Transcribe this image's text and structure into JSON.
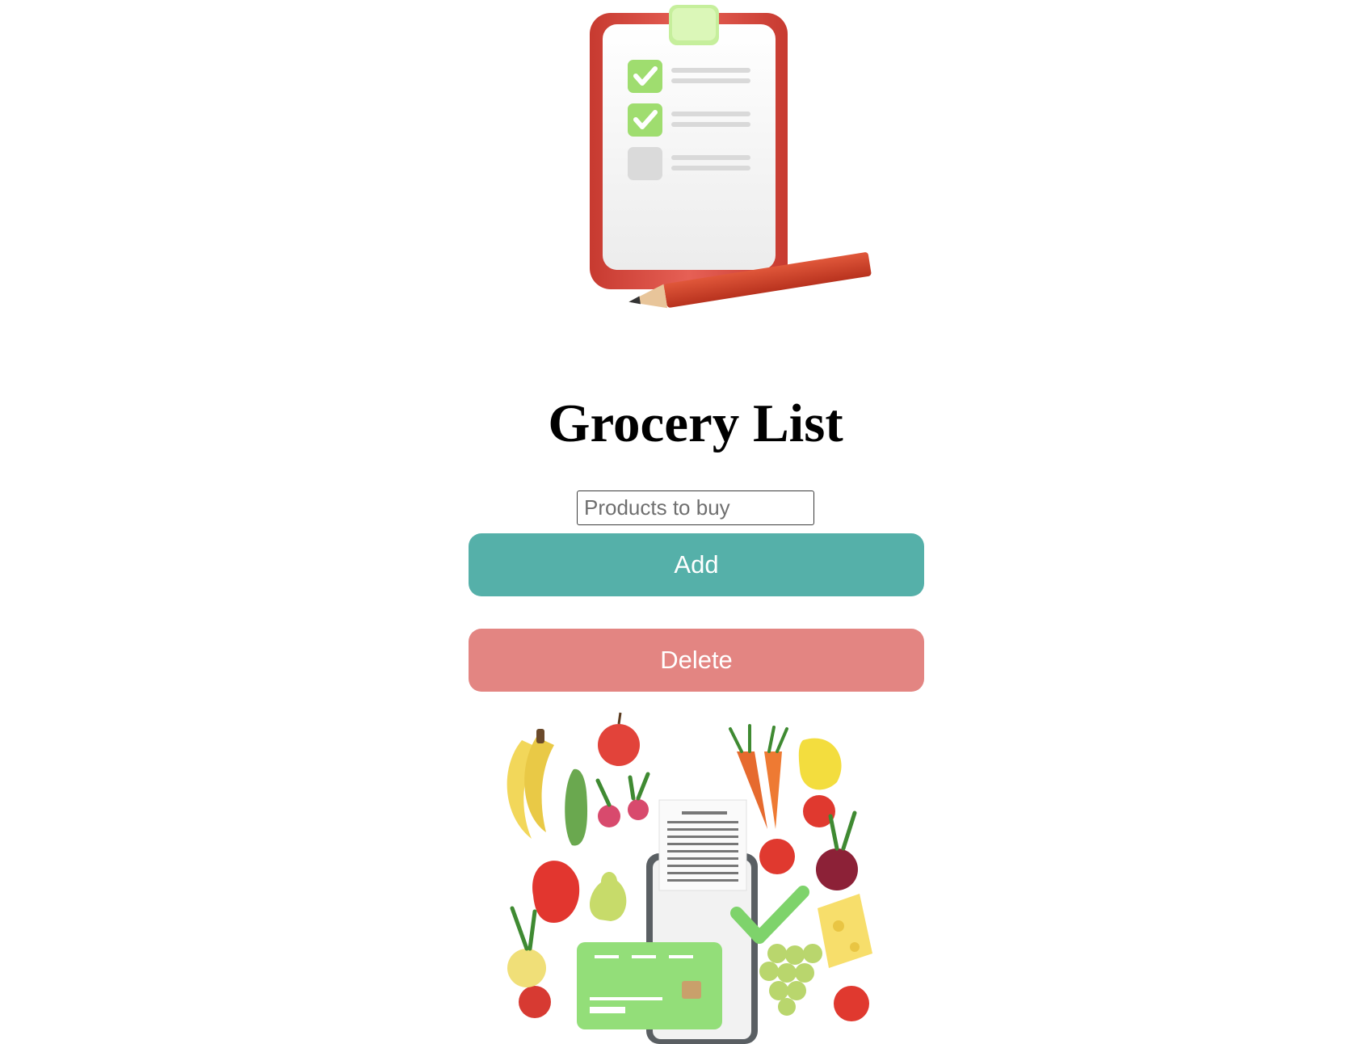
{
  "page": {
    "title": "Grocery List"
  },
  "form": {
    "input_value": "",
    "input_placeholder": "Products to buy",
    "add_label": "Add",
    "delete_label": "Delete"
  },
  "colors": {
    "add_button": "#55b0a9",
    "delete_button": "#e38582",
    "clipboard_frame": "#d64b3e",
    "checkbox_green": "#9fdd6f",
    "card_green": "#93de79"
  },
  "icons": {
    "hero": "clipboard-checklist-icon",
    "footer": "groceries-phone-payment-icon"
  }
}
